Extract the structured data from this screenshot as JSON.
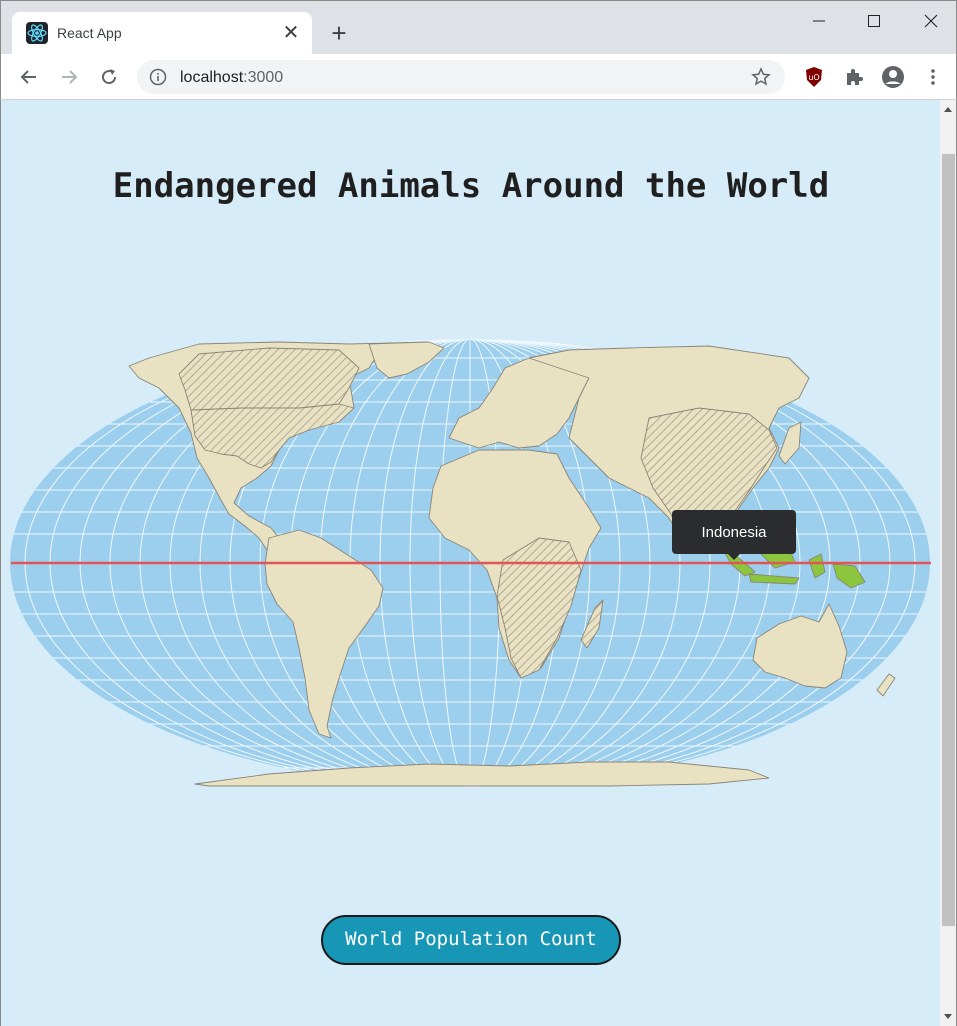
{
  "browser": {
    "tab_title": "React App",
    "tab_close": "✕",
    "new_tab": "+",
    "url_host": "localhost",
    "url_port": ":3000"
  },
  "page": {
    "title": "Endangered Animals Around the World",
    "tooltip": "Indonesia",
    "button_label": "World Population Count"
  },
  "map": {
    "highlighted_country": "Indonesia",
    "equator_line": true
  },
  "colors": {
    "page_bg": "#d6ecf8",
    "ocean": "#9ccfed",
    "land": "#e9e2c2",
    "land_border": "#8a8478",
    "hatch": "#9b9383",
    "highlight": "#8cc63f",
    "equator": "#e05555",
    "button_bg": "#1797b5"
  }
}
